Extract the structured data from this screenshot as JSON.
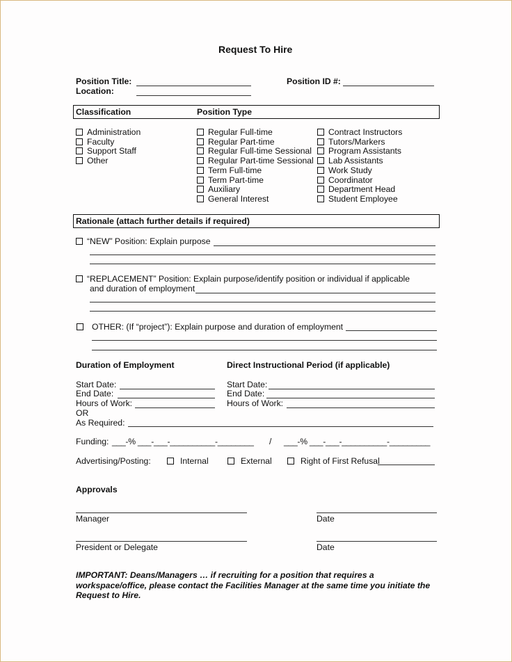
{
  "title": "Request To Hire",
  "header": {
    "position_title_label": "Position Title:",
    "location_label": "Location:",
    "position_id_label": "Position ID #:"
  },
  "classification": {
    "heading": "Classification",
    "items": [
      "Administration",
      "Faculty",
      "Support Staff",
      "Other"
    ]
  },
  "position_type": {
    "heading": "Position Type",
    "col1": [
      "Regular Full-time",
      "Regular Part-time",
      "Regular Full-time Sessional",
      "Regular Part-time Sessional",
      "Term Full-time",
      "Term Part-time",
      "Auxiliary",
      "General Interest"
    ],
    "col2": [
      "Contract Instructors",
      "Tutors/Markers",
      "Program Assistants",
      "Lab Assistants",
      "Work Study",
      "Coordinator",
      "Department Head",
      "Student Employee"
    ]
  },
  "rationale": {
    "heading": "Rationale (attach further details if required)",
    "new_label": "“NEW” Position:  Explain purpose",
    "replacement_label": "“REPLACEMENT” Position:  Explain purpose/identify position or individual if applicable",
    "replacement_label2": "and duration of employment",
    "other_label": "OTHER:  (If “project”):  Explain purpose and duration of employment"
  },
  "duration": {
    "heading": "Duration of Employment",
    "start_label": "Start Date:",
    "end_label": "End Date:",
    "hours_label": "Hours of Work:",
    "or_label": "OR",
    "as_required_label": "As Required:"
  },
  "instructional": {
    "heading": "Direct Instructional Period (if applicable)",
    "start_label": "Start Date:",
    "end_label": "End Date:",
    "hours_label": "Hours of Work:"
  },
  "funding": {
    "label": "Funding:",
    "pattern_left": "___-% ___-___-__________-________",
    "separator": "/",
    "pattern_right": "___-% ___-___-__________-_________"
  },
  "advertising": {
    "label": "Advertising/Posting:",
    "options": [
      "Internal",
      "External",
      "Right of First Refusal"
    ]
  },
  "approvals": {
    "heading": "Approvals",
    "manager_label": "Manager",
    "president_label": "President or Delegate",
    "date_label": "Date"
  },
  "important_note": "IMPORTANT:  Deans/Managers … if recruiting for a position that requires a workspace/office, please contact the Facilities Manager at the same time you initiate the Request to Hire."
}
